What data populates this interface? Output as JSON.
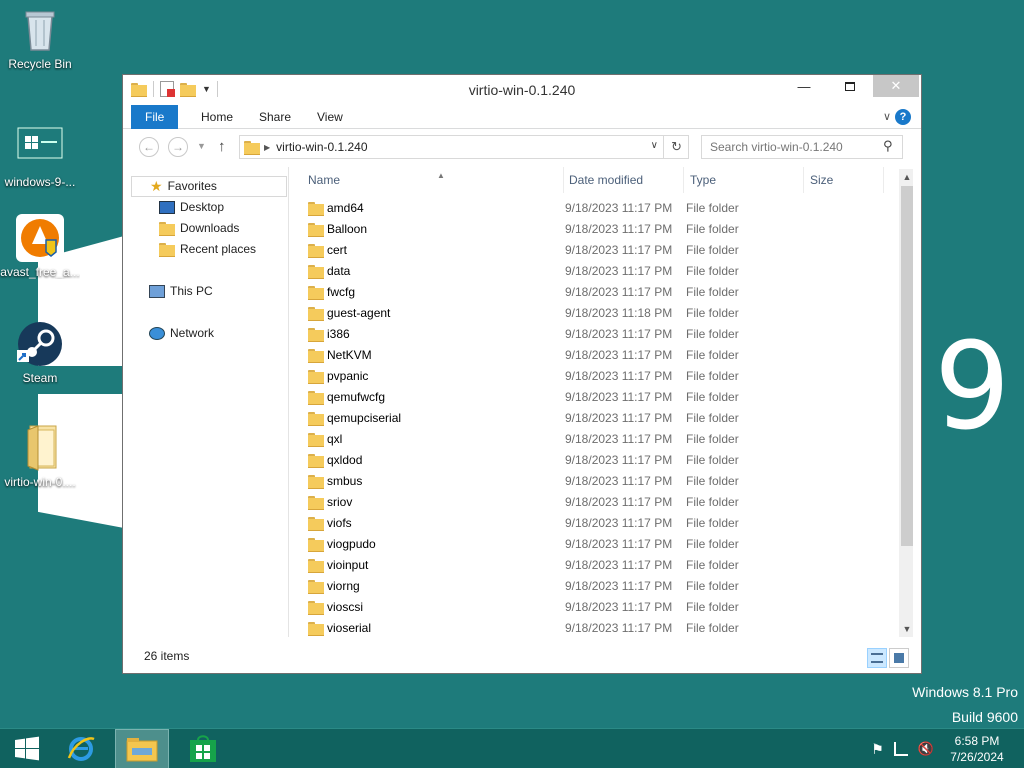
{
  "desktop": {
    "icons": [
      {
        "label": "Recycle Bin",
        "icon": "recycle-bin-icon"
      },
      {
        "label": "windows-9-...",
        "icon": "windows-image-icon"
      },
      {
        "label": "avast_free_a...",
        "icon": "avast-icon"
      },
      {
        "label": "Steam",
        "icon": "steam-icon"
      },
      {
        "label": "virtio-win-0....",
        "icon": "folder-icon"
      }
    ],
    "wallpaper_number": "9",
    "watermark": {
      "line1": "Windows 8.1 Pro",
      "line2": "Build 9600"
    }
  },
  "window": {
    "title": "virtio-win-0.1.240",
    "ribbon_tabs": [
      "File",
      "Home",
      "Share",
      "View"
    ],
    "address_path": "virtio-win-0.1.240",
    "search_placeholder": "Search virtio-win-0.1.240",
    "nav_pane": {
      "favorites": "Favorites",
      "favorites_items": [
        "Desktop",
        "Downloads",
        "Recent places"
      ],
      "this_pc": "This PC",
      "network": "Network"
    },
    "columns": [
      "Name",
      "Date modified",
      "Type",
      "Size"
    ],
    "files": [
      {
        "name": "amd64",
        "date": "9/18/2023 11:17 PM",
        "type": "File folder"
      },
      {
        "name": "Balloon",
        "date": "9/18/2023 11:17 PM",
        "type": "File folder"
      },
      {
        "name": "cert",
        "date": "9/18/2023 11:17 PM",
        "type": "File folder"
      },
      {
        "name": "data",
        "date": "9/18/2023 11:17 PM",
        "type": "File folder"
      },
      {
        "name": "fwcfg",
        "date": "9/18/2023 11:17 PM",
        "type": "File folder"
      },
      {
        "name": "guest-agent",
        "date": "9/18/2023 11:18 PM",
        "type": "File folder"
      },
      {
        "name": "i386",
        "date": "9/18/2023 11:17 PM",
        "type": "File folder"
      },
      {
        "name": "NetKVM",
        "date": "9/18/2023 11:17 PM",
        "type": "File folder"
      },
      {
        "name": "pvpanic",
        "date": "9/18/2023 11:17 PM",
        "type": "File folder"
      },
      {
        "name": "qemufwcfg",
        "date": "9/18/2023 11:17 PM",
        "type": "File folder"
      },
      {
        "name": "qemupciserial",
        "date": "9/18/2023 11:17 PM",
        "type": "File folder"
      },
      {
        "name": "qxl",
        "date": "9/18/2023 11:17 PM",
        "type": "File folder"
      },
      {
        "name": "qxldod",
        "date": "9/18/2023 11:17 PM",
        "type": "File folder"
      },
      {
        "name": "smbus",
        "date": "9/18/2023 11:17 PM",
        "type": "File folder"
      },
      {
        "name": "sriov",
        "date": "9/18/2023 11:17 PM",
        "type": "File folder"
      },
      {
        "name": "viofs",
        "date": "9/18/2023 11:17 PM",
        "type": "File folder"
      },
      {
        "name": "viogpudo",
        "date": "9/18/2023 11:17 PM",
        "type": "File folder"
      },
      {
        "name": "vioinput",
        "date": "9/18/2023 11:17 PM",
        "type": "File folder"
      },
      {
        "name": "viorng",
        "date": "9/18/2023 11:17 PM",
        "type": "File folder"
      },
      {
        "name": "vioscsi",
        "date": "9/18/2023 11:17 PM",
        "type": "File folder"
      },
      {
        "name": "vioserial",
        "date": "9/18/2023 11:17 PM",
        "type": "File folder"
      }
    ],
    "status_count": "26 items"
  },
  "taskbar": {
    "clock_time": "6:58 PM",
    "clock_date": "7/26/2024"
  },
  "colors": {
    "desktop_bg": "#1e7b7b",
    "taskbar_bg": "#10625f",
    "accent": "#1979ca",
    "folder": "#f5cb5c"
  }
}
